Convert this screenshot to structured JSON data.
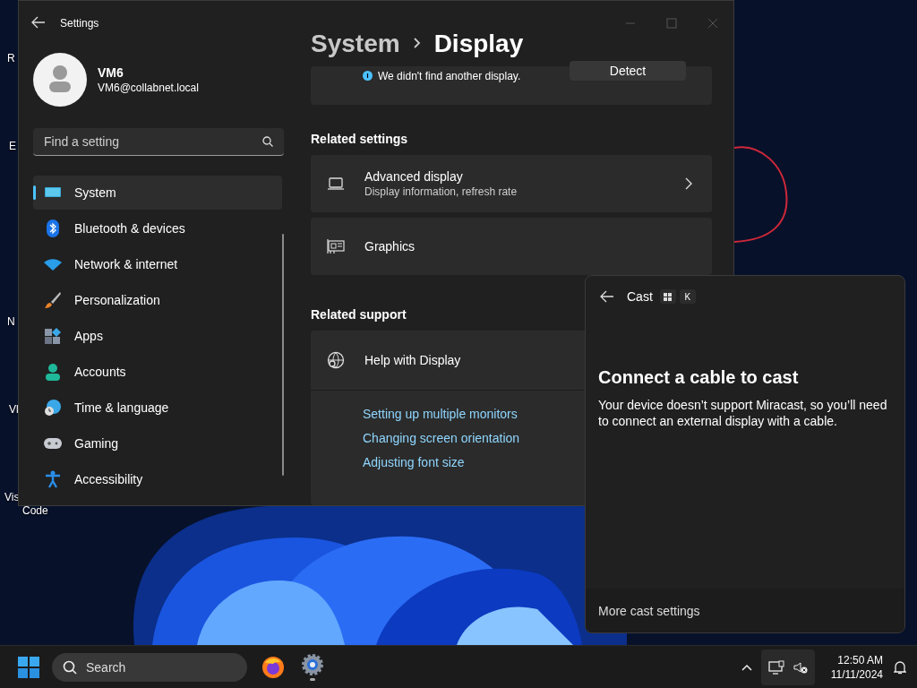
{
  "desktop_icons": [
    {
      "label": "R"
    },
    {
      "label": "E"
    },
    {
      "label": "N"
    },
    {
      "label": "Vl"
    },
    {
      "label": "Vis"
    },
    {
      "label": "Code"
    }
  ],
  "settings": {
    "title": "Settings",
    "user": {
      "name": "VM6",
      "email": "VM6@collabnet.local"
    },
    "search": {
      "placeholder": "Find a setting"
    },
    "nav": [
      {
        "label": "System",
        "selected": true
      },
      {
        "label": "Bluetooth & devices",
        "selected": false
      },
      {
        "label": "Network & internet",
        "selected": false
      },
      {
        "label": "Personalization",
        "selected": false
      },
      {
        "label": "Apps",
        "selected": false
      },
      {
        "label": "Accounts",
        "selected": false
      },
      {
        "label": "Time & language",
        "selected": false
      },
      {
        "label": "Gaming",
        "selected": false
      },
      {
        "label": "Accessibility",
        "selected": false
      }
    ],
    "breadcrumb": [
      "System",
      "Display"
    ],
    "detect_card": {
      "message": "We didn't find another display.",
      "button": "Detect"
    },
    "related_settings": {
      "heading": "Related settings",
      "items": [
        {
          "title": "Advanced display",
          "subtitle": "Display information, refresh rate"
        },
        {
          "title": "Graphics"
        }
      ]
    },
    "related_support": {
      "heading": "Related support",
      "title": "Help with Display",
      "links": [
        "Setting up multiple monitors",
        "Changing screen orientation",
        "Adjusting font size"
      ]
    }
  },
  "cast": {
    "title": "Cast",
    "shortcut_key": "K",
    "heading": "Connect a cable to cast",
    "body": "Your device doesn’t support Miracast, so you’ll need to connect an external display with a cable.",
    "footer": "More cast settings"
  },
  "taskbar": {
    "search": "Search",
    "time": "12:50 AM",
    "date": "11/11/2024"
  }
}
